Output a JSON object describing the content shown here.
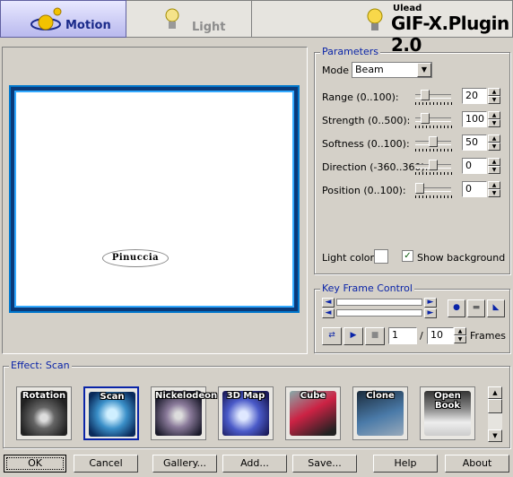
{
  "tabs": {
    "motion": "Motion",
    "light": "Light"
  },
  "brand": {
    "small": "Ulead",
    "big": "GIF-X.Plugin 2.0"
  },
  "preview": {
    "text": "Pinuccia"
  },
  "parameters": {
    "title": "Parameters",
    "mode_label": "Mode",
    "mode_value": "Beam",
    "rows": [
      {
        "label": "Range (0..100):",
        "value": "20",
        "level": 0.2
      },
      {
        "label": "Strength (0..500):",
        "value": "100",
        "level": 0.2
      },
      {
        "label": "Softness (0..100):",
        "value": "50",
        "level": 0.5
      },
      {
        "label": "Direction (-360..360):",
        "value": "0",
        "level": 0.5
      },
      {
        "label": "Position (0..100):",
        "value": "0",
        "level": 0.0
      }
    ],
    "light_color_label": "Light color:",
    "show_background_label": "Show background",
    "show_background_checked": true
  },
  "keyframe": {
    "title": "Key Frame Control",
    "frame_current": "1",
    "frame_sep": "/",
    "frame_total": "10",
    "frames_label": "Frames"
  },
  "effects": {
    "title": "Effect: Scan",
    "items": [
      {
        "label": "Rotation",
        "selected": false
      },
      {
        "label": "Scan",
        "selected": true
      },
      {
        "label": "Nickelodeon",
        "selected": false
      },
      {
        "label": "3D Map",
        "selected": false
      },
      {
        "label": "Cube",
        "selected": false
      },
      {
        "label": "Clone",
        "selected": false
      },
      {
        "label": "Open Book",
        "selected": false
      }
    ]
  },
  "buttons": {
    "ok": "OK",
    "cancel": "Cancel",
    "gallery": "Gallery...",
    "add": "Add...",
    "save": "Save...",
    "help": "Help",
    "about": "About"
  },
  "colors": {
    "accent": "#0a24a8",
    "frame": "#0077cc"
  }
}
